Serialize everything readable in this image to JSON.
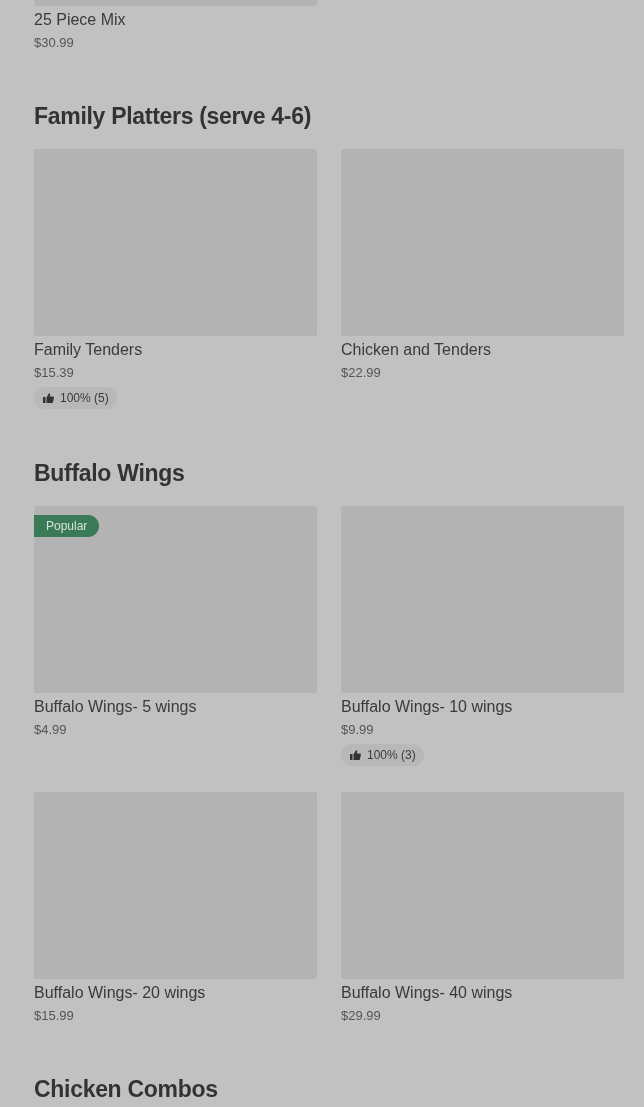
{
  "sections": [
    {
      "items": [
        {
          "name": "25 Piece Mix",
          "price": "$30.99"
        }
      ]
    },
    {
      "title": "Family Platters (serve 4-6)",
      "items": [
        {
          "name": "Family Tenders",
          "price": "$15.39",
          "rating": "100% (5)"
        },
        {
          "name": "Chicken and Tenders",
          "price": "$22.99"
        }
      ]
    },
    {
      "title": "Buffalo Wings",
      "items": [
        {
          "name": "Buffalo Wings- 5 wings",
          "price": "$4.99",
          "badge": "Popular"
        },
        {
          "name": "Buffalo Wings- 10 wings",
          "price": "$9.99",
          "rating": "100% (3)"
        },
        {
          "name": "Buffalo Wings- 20 wings",
          "price": "$15.99"
        },
        {
          "name": "Buffalo Wings- 40 wings",
          "price": "$29.99"
        }
      ]
    },
    {
      "title": "Chicken Combos"
    }
  ]
}
